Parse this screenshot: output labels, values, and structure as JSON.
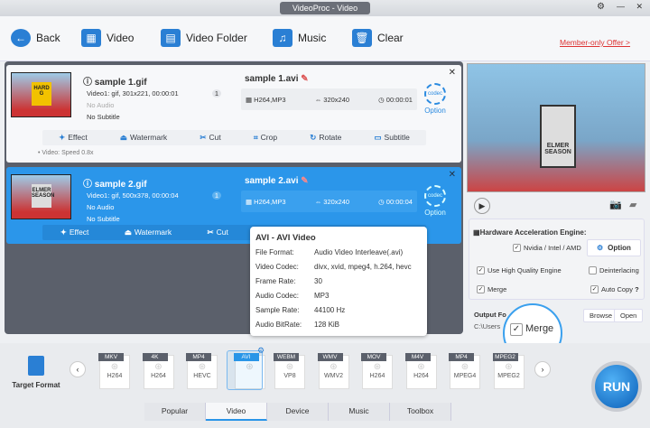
{
  "window": {
    "title": "VideoProc - Video"
  },
  "toolbar": {
    "back": "Back",
    "video": "Video",
    "video_folder": "Video Folder",
    "music": "Music",
    "clear": "Clear",
    "offer": "Member-only Offer >"
  },
  "items": [
    {
      "name": "sample 1.gif",
      "video": "Video1: gif, 301x221, 00:00:01",
      "audio": "No Audio",
      "subtitle": "No Subtitle",
      "track": "1",
      "out_name": "sample 1.avi",
      "codec": "H264,MP3",
      "res": "320x240",
      "dur": "00:00:01",
      "option": "Option",
      "thumb_text": "HARD G",
      "note": "Video: Speed 0.8x"
    },
    {
      "name": "sample 2.gif",
      "video": "Video1: gif, 500x378, 00:00:04",
      "audio": "No Audio",
      "subtitle": "No Subtitle",
      "track": "1",
      "out_name": "sample 2.avi",
      "codec": "H264,MP3",
      "res": "320x240",
      "dur": "00:00:04",
      "option": "Option",
      "thumb_text": "ELMER SEASON"
    }
  ],
  "edit": {
    "effect": "Effect",
    "watermark": "Watermark",
    "cut": "Cut",
    "crop": "Crop",
    "rotate": "Rotate",
    "subtitle": "Subtitle"
  },
  "tooltip": {
    "title": "AVI - AVI Video",
    "rows": [
      [
        "File Format:",
        "Audio Video Interleave(.avi)"
      ],
      [
        "Video Codec:",
        "divx, xvid, mpeg4, h.264, hevc"
      ],
      [
        "Frame Rate:",
        "30"
      ],
      [
        "Audio Codec:",
        "MP3"
      ],
      [
        "Sample Rate:",
        "44100 Hz"
      ],
      [
        "Audio BitRate:",
        "128 KiB"
      ]
    ]
  },
  "preview": {
    "sign": "ELMER SEASON"
  },
  "settings": {
    "title": "Hardware Acceleration Engine:",
    "hw": "Nvidia / Intel / AMD",
    "option": "Option",
    "hq": "Use High Quality Engine",
    "deint": "Deinterlacing",
    "merge": "Merge",
    "autocopy": "Auto Copy",
    "help": "?",
    "output_label": "Output Fo",
    "path": "C:\\Users",
    "browse": "Browse",
    "open": "Open",
    "callout": "Merge"
  },
  "formats": [
    {
      "tag": "MKV",
      "codec": "H264"
    },
    {
      "tag": "4K",
      "codec": "H264"
    },
    {
      "tag": "MP4",
      "codec": "HEVC"
    },
    {
      "tag": "AVI",
      "codec": ""
    },
    {
      "tag": "WEBM",
      "codec": "VP8"
    },
    {
      "tag": "WMV",
      "codec": "WMV2"
    },
    {
      "tag": "MOV",
      "codec": "H264"
    },
    {
      "tag": "M4V",
      "codec": "H264"
    },
    {
      "tag": "MP4",
      "codec": "MPEG4"
    },
    {
      "tag": "MPEG2",
      "codec": "MPEG2"
    }
  ],
  "target_format": "Target Format",
  "tabs": [
    "Popular",
    "Video",
    "Device",
    "Music",
    "Toolbox"
  ],
  "run": "RUN"
}
